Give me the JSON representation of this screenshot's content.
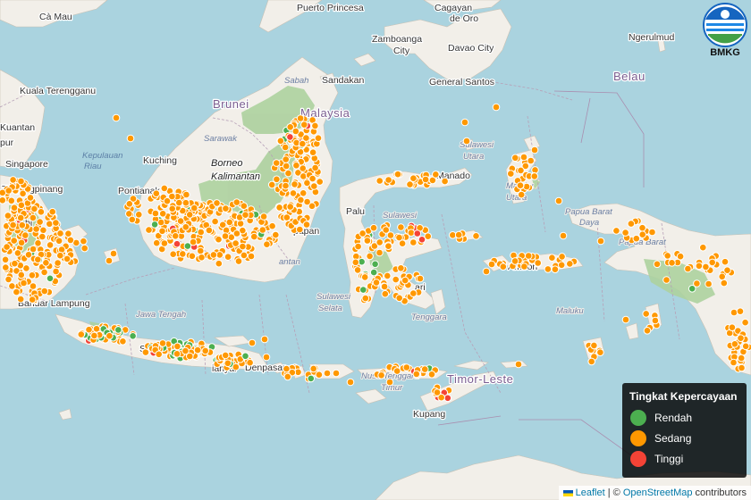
{
  "colors": {
    "rendah": "#4caf50",
    "sedang": "#ff9800",
    "tinggi": "#f44336",
    "water": "#aad3df",
    "land": "#f2efe9",
    "forest": "#add19e",
    "border": "#b8a6b8"
  },
  "logo": {
    "text": "BMKG"
  },
  "legend": {
    "title": "Tingkat Kepercayaan",
    "items": [
      {
        "label": "Rendah",
        "color": "#4caf50"
      },
      {
        "label": "Sedang",
        "color": "#ff9800"
      },
      {
        "label": "Tinggi",
        "color": "#f44336"
      }
    ]
  },
  "attribution": {
    "leaflet": "Leaflet",
    "sep": " | © ",
    "osm": "OpenStreetMap",
    "tail": " contributors"
  },
  "labels": {
    "ca_mau": "Cà Mau",
    "puerto_princesa": "Puerto Princesa",
    "cagayan": "Cagayan",
    "de_oro": "de Oro",
    "zamboanga": "Zamboanga",
    "city1": "City",
    "davao": "Davao City",
    "ngerulmud": "Ngerulmud",
    "belau": "Belau",
    "general_santos": "General Santos",
    "sandakan": "Sandakan",
    "sabah": "Sabah",
    "brunei": "Brunei",
    "malaysia": "Malaysia",
    "kuala_terengganu": "Kuala Terengganu",
    "kuantan": "Kuantan",
    "pur": "pur",
    "singapore": "Singapore",
    "tanjungpinang": "Tanjungpinang",
    "kepulauan": "Kepulauan",
    "riau": "Riau",
    "sarawak": "Sarawak",
    "kuching": "Kuching",
    "borneo": "Borneo",
    "kalimantan": "Kalimantan",
    "pontianak": "Pontianak",
    "papan": "papan",
    "antan": "antan",
    "bi": "bi",
    "bandar_lampung": "Bandar Lampung",
    "kar": "kar",
    "jawa_tengah": "Jawa Tengah",
    "sem": "Sem",
    "denpasar": "Denpasar",
    "palu": "Palu",
    "sulawesi_tengah": "Sulawesi",
    "sulawesi_selatan1": "Sulawesi",
    "sulawesi_selatan2": "Selata",
    "ari": "ari",
    "tenggara": "Tenggara",
    "manado": "Manado",
    "sulawesi_utara1": "Sulawesi",
    "sulawesi_utara2": "Utara",
    "maluku_utara1": "Maluku",
    "maluku_utara2": "Utara",
    "ambon": "Ambon",
    "maluku": "Maluku",
    "papua_barat_daya1": "Papua Barat",
    "papua_barat_daya2": "Daya",
    "papua_barat": "Papua Barat",
    "nusa_tenggara": "Nusa Tenggara",
    "timur": "Timur",
    "timor_leste": "Timor-Leste",
    "kupang": "Kupang",
    "gianyar": "ianyar"
  }
}
